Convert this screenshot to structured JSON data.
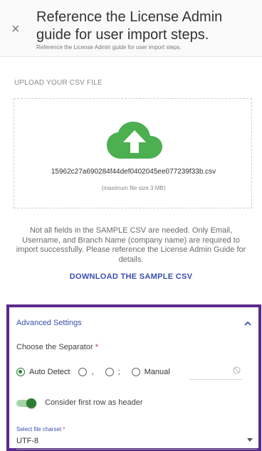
{
  "header": {
    "close_symbol": "×",
    "title": "Reference the License Admin guide for user import steps.",
    "subtitle": "Reference the License Admin guide for user import steps."
  },
  "upload": {
    "section_label": "UPLOAD YOUR CSV FILE",
    "icon": "cloud-upload-icon",
    "icon_color": "#4caf50",
    "file_name": "15962c27a690284f44def0402045ee077239f33b.csv",
    "max_size_note": "(maximum file size 3 MB)"
  },
  "notice": {
    "text": "Not all fields in the SAMPLE CSV are needed. Only Email, Username, and Branch Name (company name) are required to import successfully. Please reference the License Admin Guide for details."
  },
  "download_link": "DOWNLOAD THE SAMPLE CSV",
  "advanced": {
    "title": "Advanced Settings",
    "expanded": true,
    "border_color": "#5a2a8c",
    "separator_label": "Choose the Separator",
    "required_mark": "*",
    "separator_options": [
      {
        "label": "Auto Detect",
        "selected": true
      },
      {
        "label": ",",
        "selected": false
      },
      {
        "label": ";",
        "selected": false
      },
      {
        "label": "Manual",
        "selected": false
      }
    ],
    "manual_value": "",
    "header_toggle_label": "Consider first row as header",
    "header_toggle_on": true,
    "charset_label": "Select file charset",
    "charset_value": "UTF-8"
  },
  "colors": {
    "accent": "#3a4fb0",
    "toggle_green": "#2e7d32",
    "required": "#d0312d"
  }
}
